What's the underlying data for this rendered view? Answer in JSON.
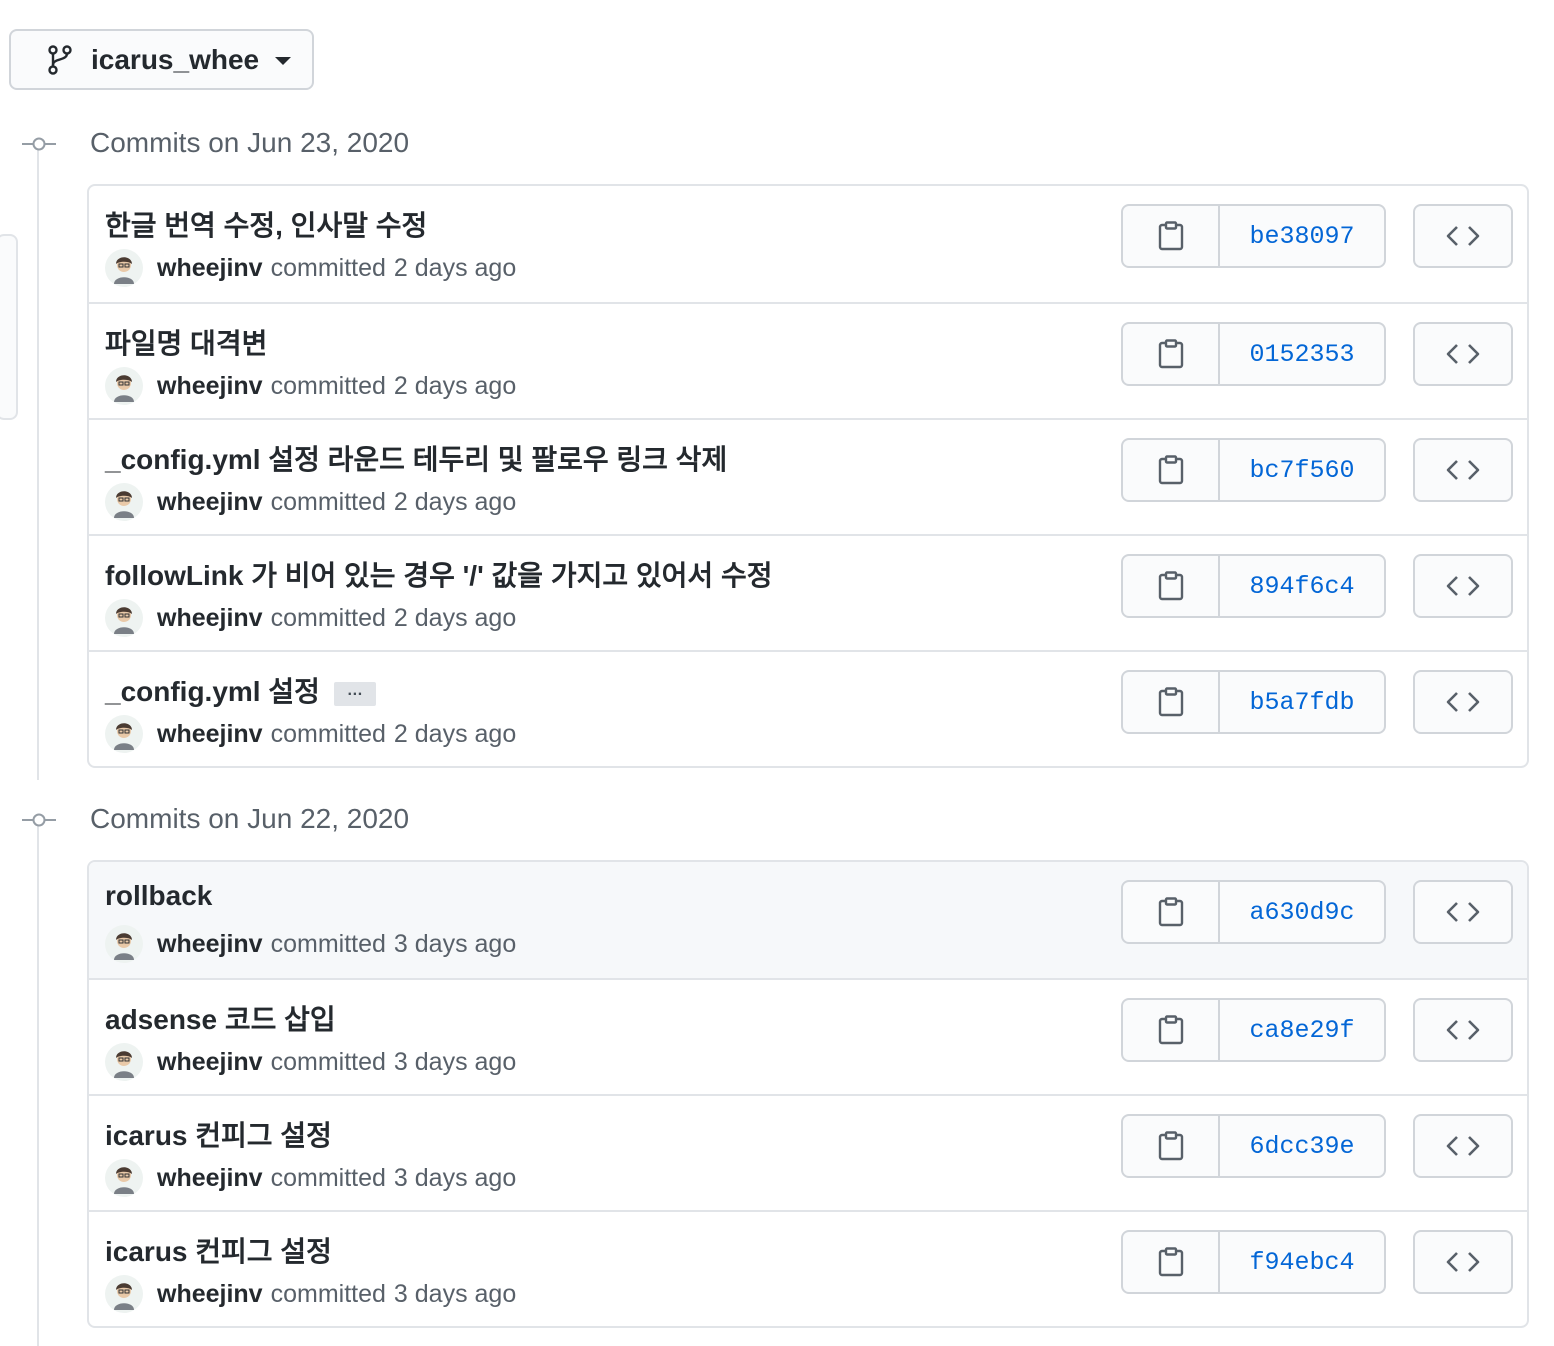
{
  "branch": {
    "name": "icarus_whee"
  },
  "groups": [
    {
      "title": "Commits on Jun 23, 2020",
      "commits": [
        {
          "message": "한글 번역 수정, 인사말 수정",
          "author": "wheejinv",
          "committed": "committed",
          "time": "2 days ago",
          "sha": "be38097"
        },
        {
          "message": "파일명 대격변",
          "author": "wheejinv",
          "committed": "committed",
          "time": "2 days ago",
          "sha": "0152353"
        },
        {
          "message": "_config.yml 설정 라운드 테두리 및 팔로우 링크 삭제",
          "author": "wheejinv",
          "committed": "committed",
          "time": "2 days ago",
          "sha": "bc7f560"
        },
        {
          "message": "followLink 가 비어 있는 경우 '/' 값을 가지고 있어서 수정",
          "author": "wheejinv",
          "committed": "committed",
          "time": "2 days ago",
          "sha": "894f6c4"
        },
        {
          "message": "_config.yml 설정",
          "author": "wheejinv",
          "committed": "committed",
          "time": "2 days ago",
          "sha": "b5a7fdb",
          "ellipsis": "…"
        }
      ]
    },
    {
      "title": "Commits on Jun 22, 2020",
      "commits": [
        {
          "message": "rollback",
          "author": "wheejinv",
          "committed": "committed",
          "time": "3 days ago",
          "sha": "a630d9c"
        },
        {
          "message": "adsense 코드 삽입",
          "author": "wheejinv",
          "committed": "committed",
          "time": "3 days ago",
          "sha": "ca8e29f"
        },
        {
          "message": "icarus 컨피그 설정",
          "author": "wheejinv",
          "committed": "committed",
          "time": "3 days ago",
          "sha": "6dcc39e"
        },
        {
          "message": "icarus 컨피그 설정",
          "author": "wheejinv",
          "committed": "committed",
          "time": "3 days ago",
          "sha": "f94ebc4"
        }
      ]
    }
  ],
  "icons": {
    "branch": "git-branch-icon",
    "caret": "caret-down-icon",
    "commit": "git-commit-icon",
    "copy": "clipboard-icon",
    "browse": "code-icon",
    "avatar": "user-avatar"
  },
  "colors": {
    "link": "#0366d6",
    "text": "#24292e",
    "muted": "#586069",
    "border": "#e1e4e8",
    "hover_row": "#f6f8fa"
  }
}
